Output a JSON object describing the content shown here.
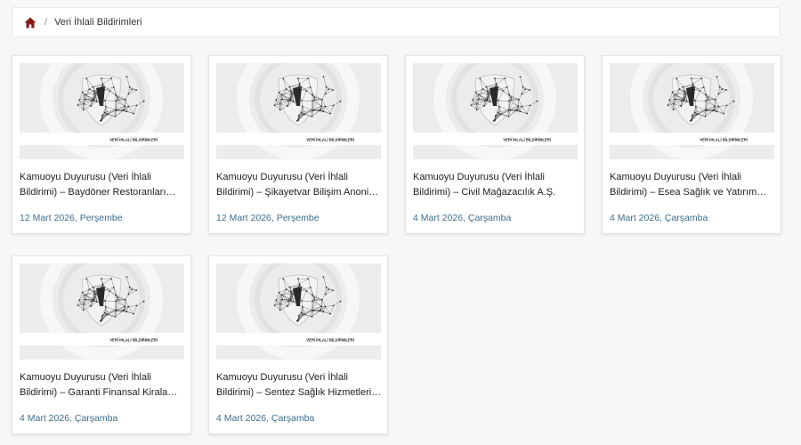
{
  "breadcrumb": {
    "home_icon": "home-icon",
    "home_color": "#8b1a1a",
    "separator": "/",
    "current": "Veri İhlali Bildirimleri"
  },
  "cards": [
    {
      "title": "Kamuoyu Duyurusu (Veri İhlali Bildirimi) – Baydöner Restoranları A.Ş.",
      "date": "12 Mart 2026, Perşembe",
      "thumb_caption": "VERİ İHLALİ BİLDİRİMLERİ"
    },
    {
      "title": "Kamuoyu Duyurusu (Veri İhlali Bildirimi) – Şikayetvar Bilişim Anonim Şirketi",
      "date": "12 Mart 2026, Perşembe",
      "thumb_caption": "VERİ İHLALİ BİLDİRİMLERİ"
    },
    {
      "title": "Kamuoyu Duyurusu (Veri İhlali Bildirimi) – Civil Mağazacılık A.Ş.",
      "date": "4 Mart 2026, Çarşamba",
      "thumb_caption": "VERİ İHLALİ BİLDİRİMLERİ"
    },
    {
      "title": "Kamuoyu Duyurusu (Veri İhlali Bildirimi) – Esea Sağlık ve Yatırım A.Ş.",
      "date": "4 Mart 2026, Çarşamba",
      "thumb_caption": "VERİ İHLALİ BİLDİRİMLERİ"
    },
    {
      "title": "Kamuoyu Duyurusu (Veri İhlali Bildirimi) – Garanti Finansal Kiralama A.Ş.",
      "date": "4 Mart 2026, Çarşamba",
      "thumb_caption": "VERİ İHLALİ BİLDİRİMLERİ"
    },
    {
      "title": "Kamuoyu Duyurusu (Veri İhlali Bildirimi) – Sentez Sağlık Hizmetleri A.Ş.",
      "date": "4 Mart 2026, Çarşamba",
      "thumb_caption": "VERİ İHLALİ BİLDİRİMLERİ"
    }
  ],
  "colors": {
    "date_text": "#3d6d8f",
    "card_background": "#ffffff",
    "page_background": "#f7f7f7"
  }
}
